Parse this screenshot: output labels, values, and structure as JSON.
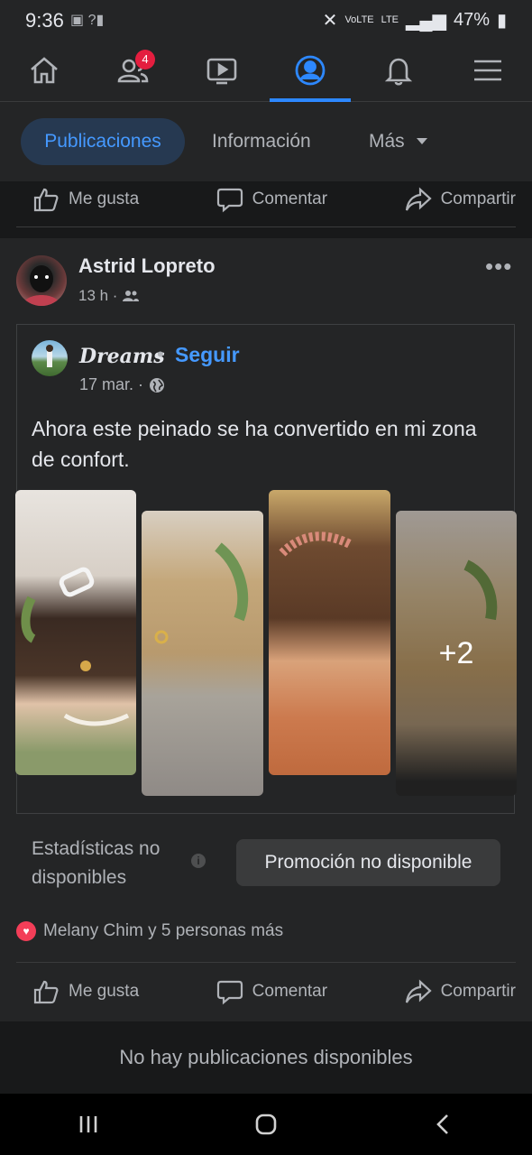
{
  "status_bar": {
    "time": "9:36",
    "battery": "47%",
    "network_label": "LTE",
    "volte_label": "VoLTE"
  },
  "nav": {
    "items": [
      {
        "icon": "home-icon"
      },
      {
        "icon": "friends-icon",
        "badge": "4"
      },
      {
        "icon": "watch-icon"
      },
      {
        "icon": "profile-icon",
        "active": true
      },
      {
        "icon": "bell-icon"
      },
      {
        "icon": "menu-icon"
      }
    ]
  },
  "tabs": {
    "active": "Publicaciones",
    "info": "Información",
    "more": "Más"
  },
  "actions": {
    "like": "Me gusta",
    "comment": "Comentar",
    "share": "Compartir"
  },
  "post": {
    "author": "Astrid Lopreto",
    "time": "13 h ·",
    "shared": {
      "page_name": "Dreams",
      "separator": "•",
      "follow": "Seguir",
      "date": "17 mar. ·",
      "text": "Ahora este peinado se ha convertido en mi zona de confort.",
      "extra_photos": "+2"
    },
    "stats_text": "Estadísticas no disponibles",
    "promotion": "Promoción no disponible",
    "reactions_text": "Melany Chim y 5 personas más"
  },
  "footer": {
    "no_posts": "No hay publicaciones disponibles"
  },
  "colors": {
    "accent": "#4599ff",
    "background": "#18191a",
    "card": "#242526",
    "badge": "#e41e3f",
    "heart": "#f33e58"
  }
}
